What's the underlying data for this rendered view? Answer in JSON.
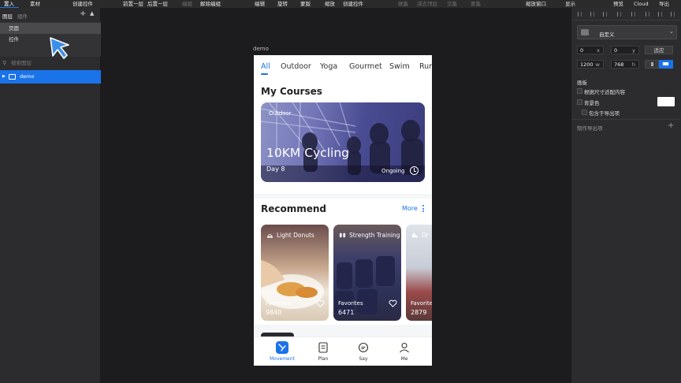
{
  "menubar": {
    "items": [
      {
        "label": "置入",
        "dim": false
      },
      {
        "label": "素材",
        "dim": false
      },
      {
        "label": "创建控件",
        "dim": false
      },
      {
        "label": "前置一层",
        "dim": false
      },
      {
        "label": "后置一层",
        "dim": false
      },
      {
        "label": "编组",
        "dim": true
      },
      {
        "label": "解除编组",
        "dim": false
      },
      {
        "label": "编辑",
        "dim": false
      },
      {
        "label": "旋转",
        "dim": false
      },
      {
        "label": "蒙版",
        "dim": false
      },
      {
        "label": "缩放",
        "dim": false
      },
      {
        "label": "创建控件",
        "dim": false
      },
      {
        "label": "联集",
        "dim": true
      },
      {
        "label": "减去顶层",
        "dim": true
      },
      {
        "label": "交集",
        "dim": true
      },
      {
        "label": "差集",
        "dim": true
      },
      {
        "label": "缩放窗口",
        "dim": false
      },
      {
        "label": "显示",
        "dim": false
      },
      {
        "label": "预览",
        "dim": false
      },
      {
        "label": "Cloud",
        "dim": false
      },
      {
        "label": "导出",
        "dim": false
      }
    ]
  },
  "left_panel": {
    "tab_layers": "图层",
    "tab_components": "组件",
    "add_icon": "plus-icon",
    "pages": [
      "页面",
      "控件"
    ],
    "search_placeholder": "搜索图层",
    "layer_name": "demo"
  },
  "canvas": {
    "artboard_label": "demo"
  },
  "phone": {
    "tabs": [
      "All",
      "Outdoor",
      "Yoga",
      "Gourmet",
      "Swim",
      "Run"
    ],
    "active_tab": "All",
    "my_courses_title": "My Courses",
    "hero": {
      "tag": "Outdoor",
      "title": "10KM Cycling",
      "day": "Day 8",
      "status": "Ongoing"
    },
    "recommend_title": "Recommend",
    "more_label": "More",
    "cards": [
      {
        "title": "Light Donuts",
        "fav_label": "Favorites",
        "count": "9840",
        "icon": "cloche-icon"
      },
      {
        "title": "Strength Training",
        "fav_label": "Favorites",
        "count": "6471",
        "icon": "dumbbell-icon"
      },
      {
        "title": "Dr",
        "fav_label": "Favorites",
        "count": "2879",
        "icon": "shoe-icon"
      }
    ],
    "tabbar": [
      {
        "label": "Movement",
        "active": true,
        "icon": "movement-icon"
      },
      {
        "label": "Plan",
        "active": false,
        "icon": "plan-icon"
      },
      {
        "label": "Say",
        "active": false,
        "icon": "chat-icon"
      },
      {
        "label": "Me",
        "active": false,
        "icon": "user-icon"
      }
    ],
    "accent": "#1a73e8"
  },
  "right_panel": {
    "preset": "自定义",
    "x": "0",
    "x_suffix": "x",
    "y": "0",
    "y_suffix": "y",
    "fit_button": "适应",
    "width": "1200",
    "width_suffix": "w",
    "height": "768",
    "height_suffix": "h",
    "section_artboard": "画板",
    "fit_content": "根据尺寸适配内容",
    "background_color": "背景色",
    "include_in_export": "包含于导出项",
    "export_section": "制作导出项"
  }
}
